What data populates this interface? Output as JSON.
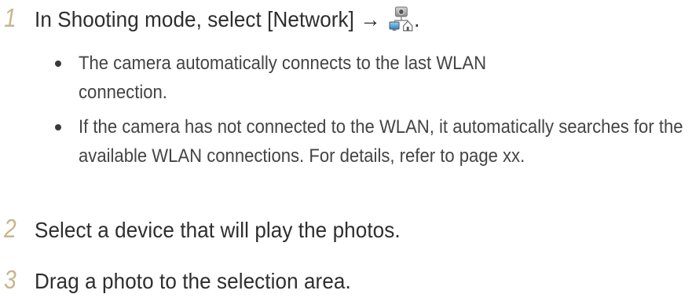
{
  "steps": [
    {
      "number": "1",
      "text_before_icon": "In Shooting mode, select [Network] → ",
      "text_after_icon": ".",
      "icon": "network-home-icon",
      "bullets": [
        "The camera automatically connects to the last WLAN connection.",
        "If the camera has not connected to the WLAN, it automatically searches for the available WLAN connections. For details, refer to page xx."
      ]
    },
    {
      "number": "2",
      "text": "Select a device that will play the photos."
    },
    {
      "number": "3",
      "text": "Drag a photo to the selection area."
    }
  ],
  "colors": {
    "step_number": "#c9b48c",
    "text": "#2e2e2e"
  }
}
